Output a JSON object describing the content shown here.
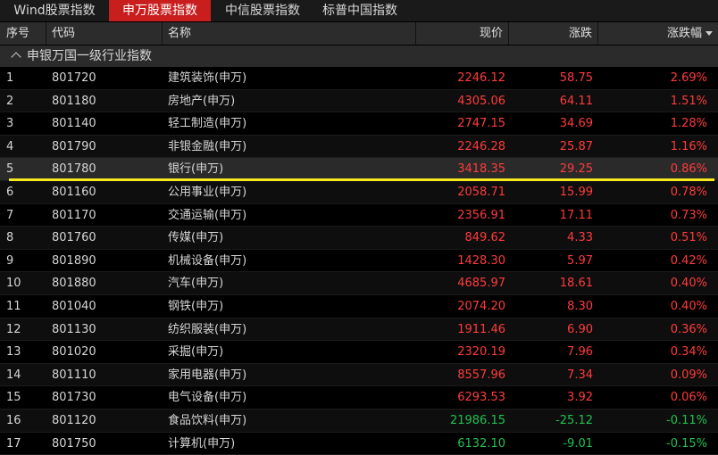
{
  "tabs": [
    "Wind股票指数",
    "申万股票指数",
    "中信股票指数",
    "标普中国指数"
  ],
  "active_tab": 1,
  "columns": {
    "seq": "序号",
    "code": "代码",
    "name": "名称",
    "price": "现价",
    "change": "涨跌",
    "pct": "涨跌幅"
  },
  "group_title": "申银万国一级行业指数",
  "colors": {
    "up": "#ff3b3b",
    "down": "#20c050",
    "active_tab": "#c81e1e",
    "highlight": "#f5e81c"
  },
  "rows": [
    {
      "seq": "1",
      "code": "801720",
      "name": "建筑装饰(申万)",
      "price": "2246.12",
      "change": "58.75",
      "pct": "2.69%",
      "dir": "up"
    },
    {
      "seq": "2",
      "code": "801180",
      "name": "房地产(申万)",
      "price": "4305.06",
      "change": "64.11",
      "pct": "1.51%",
      "dir": "up"
    },
    {
      "seq": "3",
      "code": "801140",
      "name": "轻工制造(申万)",
      "price": "2747.15",
      "change": "34.69",
      "pct": "1.28%",
      "dir": "up"
    },
    {
      "seq": "4",
      "code": "801790",
      "name": "非银金融(申万)",
      "price": "2246.28",
      "change": "25.87",
      "pct": "1.16%",
      "dir": "up"
    },
    {
      "seq": "5",
      "code": "801780",
      "name": "银行(申万)",
      "price": "3418.35",
      "change": "29.25",
      "pct": "0.86%",
      "dir": "up"
    },
    {
      "seq": "6",
      "code": "801160",
      "name": "公用事业(申万)",
      "price": "2058.71",
      "change": "15.99",
      "pct": "0.78%",
      "dir": "up"
    },
    {
      "seq": "7",
      "code": "801170",
      "name": "交通运输(申万)",
      "price": "2356.91",
      "change": "17.11",
      "pct": "0.73%",
      "dir": "up"
    },
    {
      "seq": "8",
      "code": "801760",
      "name": "传媒(申万)",
      "price": "849.62",
      "change": "4.33",
      "pct": "0.51%",
      "dir": "up"
    },
    {
      "seq": "9",
      "code": "801890",
      "name": "机械设备(申万)",
      "price": "1428.30",
      "change": "5.97",
      "pct": "0.42%",
      "dir": "up"
    },
    {
      "seq": "10",
      "code": "801880",
      "name": "汽车(申万)",
      "price": "4685.97",
      "change": "18.61",
      "pct": "0.40%",
      "dir": "up"
    },
    {
      "seq": "11",
      "code": "801040",
      "name": "钢铁(申万)",
      "price": "2074.20",
      "change": "8.30",
      "pct": "0.40%",
      "dir": "up"
    },
    {
      "seq": "12",
      "code": "801130",
      "name": "纺织服装(申万)",
      "price": "1911.46",
      "change": "6.90",
      "pct": "0.36%",
      "dir": "up"
    },
    {
      "seq": "13",
      "code": "801020",
      "name": "采掘(申万)",
      "price": "2320.19",
      "change": "7.96",
      "pct": "0.34%",
      "dir": "up"
    },
    {
      "seq": "14",
      "code": "801110",
      "name": "家用电器(申万)",
      "price": "8557.96",
      "change": "7.34",
      "pct": "0.09%",
      "dir": "up"
    },
    {
      "seq": "15",
      "code": "801730",
      "name": "电气设备(申万)",
      "price": "6293.53",
      "change": "3.92",
      "pct": "0.06%",
      "dir": "up"
    },
    {
      "seq": "16",
      "code": "801120",
      "name": "食品饮料(申万)",
      "price": "21986.15",
      "change": "-25.12",
      "pct": "-0.11%",
      "dir": "down"
    },
    {
      "seq": "17",
      "code": "801750",
      "name": "计算机(申万)",
      "price": "6132.10",
      "change": "-9.01",
      "pct": "-0.15%",
      "dir": "down"
    }
  ],
  "selected_row": 4
}
